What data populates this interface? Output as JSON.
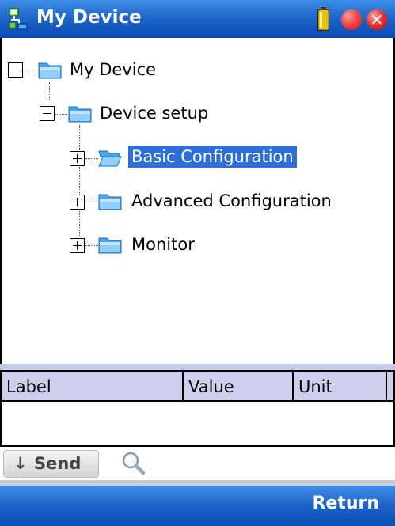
{
  "window": {
    "title": "My Device",
    "icons": [
      "device-tree-icon",
      "battery-icon",
      "record-icon",
      "close-icon"
    ]
  },
  "tree": {
    "nodes": [
      {
        "label": "My Device",
        "expanded": true,
        "selected": false,
        "icon": "folder-icon"
      },
      {
        "label": "Device setup",
        "expanded": true,
        "selected": false,
        "icon": "folder-icon"
      },
      {
        "label": "Basic Configuration",
        "expanded": false,
        "selected": true,
        "icon": "open-folder-icon"
      },
      {
        "label": "Advanced Configuration",
        "expanded": false,
        "selected": false,
        "icon": "folder-icon"
      },
      {
        "label": "Monitor",
        "expanded": false,
        "selected": false,
        "icon": "folder-icon"
      }
    ]
  },
  "properties": {
    "columns": [
      "Label",
      "Value",
      "Unit"
    ],
    "rows": []
  },
  "toolbar": {
    "send_label": "Send",
    "send_icon": "down-arrow-icon",
    "search_icon": "magnifier-icon"
  },
  "bottombar": {
    "return_label": "Return"
  },
  "colors": {
    "titlebar": "#1d63c7",
    "selection": "#2d6fd6",
    "grid_header": "#cecfef"
  }
}
